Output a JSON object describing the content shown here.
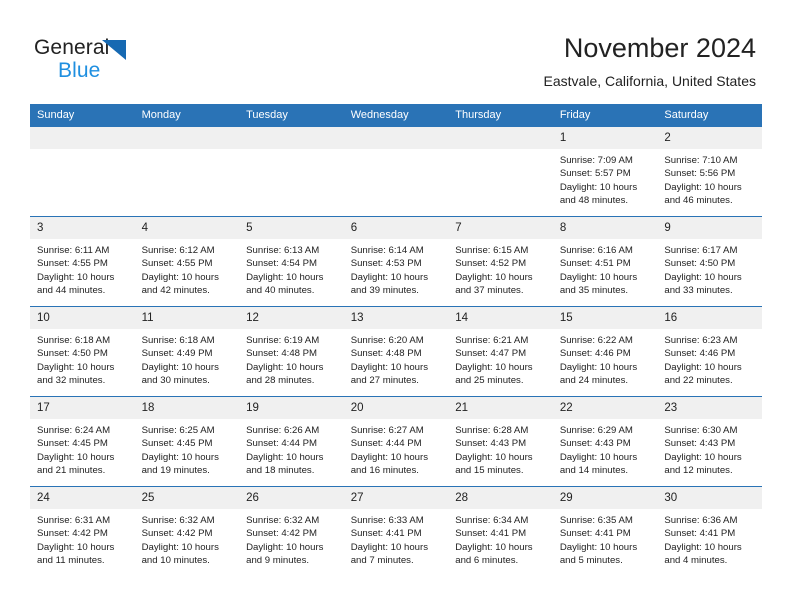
{
  "brand": {
    "name_top": "General",
    "name_bottom": "Blue",
    "accent_color": "#1f8fe0",
    "triangle_color": "#1669b2"
  },
  "header": {
    "title": "November 2024",
    "subtitle": "Eastvale, California, United States"
  },
  "theme": {
    "header_row_bg": "#2a73b6",
    "daynum_bg": "#f0f0f0",
    "grid_line": "#2a73b6",
    "text": "#222222"
  },
  "weekday_headers": [
    "Sunday",
    "Monday",
    "Tuesday",
    "Wednesday",
    "Thursday",
    "Friday",
    "Saturday"
  ],
  "weeks": [
    [
      {
        "day": "",
        "sunrise": "",
        "sunset": "",
        "daylight_1": "",
        "daylight_2": "",
        "empty": true
      },
      {
        "day": "",
        "sunrise": "",
        "sunset": "",
        "daylight_1": "",
        "daylight_2": "",
        "empty": true
      },
      {
        "day": "",
        "sunrise": "",
        "sunset": "",
        "daylight_1": "",
        "daylight_2": "",
        "empty": true
      },
      {
        "day": "",
        "sunrise": "",
        "sunset": "",
        "daylight_1": "",
        "daylight_2": "",
        "empty": true
      },
      {
        "day": "",
        "sunrise": "",
        "sunset": "",
        "daylight_1": "",
        "daylight_2": "",
        "empty": true
      },
      {
        "day": "1",
        "sunrise": "Sunrise: 7:09 AM",
        "sunset": "Sunset: 5:57 PM",
        "daylight_1": "Daylight: 10 hours",
        "daylight_2": "and 48 minutes."
      },
      {
        "day": "2",
        "sunrise": "Sunrise: 7:10 AM",
        "sunset": "Sunset: 5:56 PM",
        "daylight_1": "Daylight: 10 hours",
        "daylight_2": "and 46 minutes."
      }
    ],
    [
      {
        "day": "3",
        "sunrise": "Sunrise: 6:11 AM",
        "sunset": "Sunset: 4:55 PM",
        "daylight_1": "Daylight: 10 hours",
        "daylight_2": "and 44 minutes."
      },
      {
        "day": "4",
        "sunrise": "Sunrise: 6:12 AM",
        "sunset": "Sunset: 4:55 PM",
        "daylight_1": "Daylight: 10 hours",
        "daylight_2": "and 42 minutes."
      },
      {
        "day": "5",
        "sunrise": "Sunrise: 6:13 AM",
        "sunset": "Sunset: 4:54 PM",
        "daylight_1": "Daylight: 10 hours",
        "daylight_2": "and 40 minutes."
      },
      {
        "day": "6",
        "sunrise": "Sunrise: 6:14 AM",
        "sunset": "Sunset: 4:53 PM",
        "daylight_1": "Daylight: 10 hours",
        "daylight_2": "and 39 minutes."
      },
      {
        "day": "7",
        "sunrise": "Sunrise: 6:15 AM",
        "sunset": "Sunset: 4:52 PM",
        "daylight_1": "Daylight: 10 hours",
        "daylight_2": "and 37 minutes."
      },
      {
        "day": "8",
        "sunrise": "Sunrise: 6:16 AM",
        "sunset": "Sunset: 4:51 PM",
        "daylight_1": "Daylight: 10 hours",
        "daylight_2": "and 35 minutes."
      },
      {
        "day": "9",
        "sunrise": "Sunrise: 6:17 AM",
        "sunset": "Sunset: 4:50 PM",
        "daylight_1": "Daylight: 10 hours",
        "daylight_2": "and 33 minutes."
      }
    ],
    [
      {
        "day": "10",
        "sunrise": "Sunrise: 6:18 AM",
        "sunset": "Sunset: 4:50 PM",
        "daylight_1": "Daylight: 10 hours",
        "daylight_2": "and 32 minutes."
      },
      {
        "day": "11",
        "sunrise": "Sunrise: 6:18 AM",
        "sunset": "Sunset: 4:49 PM",
        "daylight_1": "Daylight: 10 hours",
        "daylight_2": "and 30 minutes."
      },
      {
        "day": "12",
        "sunrise": "Sunrise: 6:19 AM",
        "sunset": "Sunset: 4:48 PM",
        "daylight_1": "Daylight: 10 hours",
        "daylight_2": "and 28 minutes."
      },
      {
        "day": "13",
        "sunrise": "Sunrise: 6:20 AM",
        "sunset": "Sunset: 4:48 PM",
        "daylight_1": "Daylight: 10 hours",
        "daylight_2": "and 27 minutes."
      },
      {
        "day": "14",
        "sunrise": "Sunrise: 6:21 AM",
        "sunset": "Sunset: 4:47 PM",
        "daylight_1": "Daylight: 10 hours",
        "daylight_2": "and 25 minutes."
      },
      {
        "day": "15",
        "sunrise": "Sunrise: 6:22 AM",
        "sunset": "Sunset: 4:46 PM",
        "daylight_1": "Daylight: 10 hours",
        "daylight_2": "and 24 minutes."
      },
      {
        "day": "16",
        "sunrise": "Sunrise: 6:23 AM",
        "sunset": "Sunset: 4:46 PM",
        "daylight_1": "Daylight: 10 hours",
        "daylight_2": "and 22 minutes."
      }
    ],
    [
      {
        "day": "17",
        "sunrise": "Sunrise: 6:24 AM",
        "sunset": "Sunset: 4:45 PM",
        "daylight_1": "Daylight: 10 hours",
        "daylight_2": "and 21 minutes."
      },
      {
        "day": "18",
        "sunrise": "Sunrise: 6:25 AM",
        "sunset": "Sunset: 4:45 PM",
        "daylight_1": "Daylight: 10 hours",
        "daylight_2": "and 19 minutes."
      },
      {
        "day": "19",
        "sunrise": "Sunrise: 6:26 AM",
        "sunset": "Sunset: 4:44 PM",
        "daylight_1": "Daylight: 10 hours",
        "daylight_2": "and 18 minutes."
      },
      {
        "day": "20",
        "sunrise": "Sunrise: 6:27 AM",
        "sunset": "Sunset: 4:44 PM",
        "daylight_1": "Daylight: 10 hours",
        "daylight_2": "and 16 minutes."
      },
      {
        "day": "21",
        "sunrise": "Sunrise: 6:28 AM",
        "sunset": "Sunset: 4:43 PM",
        "daylight_1": "Daylight: 10 hours",
        "daylight_2": "and 15 minutes."
      },
      {
        "day": "22",
        "sunrise": "Sunrise: 6:29 AM",
        "sunset": "Sunset: 4:43 PM",
        "daylight_1": "Daylight: 10 hours",
        "daylight_2": "and 14 minutes."
      },
      {
        "day": "23",
        "sunrise": "Sunrise: 6:30 AM",
        "sunset": "Sunset: 4:43 PM",
        "daylight_1": "Daylight: 10 hours",
        "daylight_2": "and 12 minutes."
      }
    ],
    [
      {
        "day": "24",
        "sunrise": "Sunrise: 6:31 AM",
        "sunset": "Sunset: 4:42 PM",
        "daylight_1": "Daylight: 10 hours",
        "daylight_2": "and 11 minutes."
      },
      {
        "day": "25",
        "sunrise": "Sunrise: 6:32 AM",
        "sunset": "Sunset: 4:42 PM",
        "daylight_1": "Daylight: 10 hours",
        "daylight_2": "and 10 minutes."
      },
      {
        "day": "26",
        "sunrise": "Sunrise: 6:32 AM",
        "sunset": "Sunset: 4:42 PM",
        "daylight_1": "Daylight: 10 hours",
        "daylight_2": "and 9 minutes."
      },
      {
        "day": "27",
        "sunrise": "Sunrise: 6:33 AM",
        "sunset": "Sunset: 4:41 PM",
        "daylight_1": "Daylight: 10 hours",
        "daylight_2": "and 7 minutes."
      },
      {
        "day": "28",
        "sunrise": "Sunrise: 6:34 AM",
        "sunset": "Sunset: 4:41 PM",
        "daylight_1": "Daylight: 10 hours",
        "daylight_2": "and 6 minutes."
      },
      {
        "day": "29",
        "sunrise": "Sunrise: 6:35 AM",
        "sunset": "Sunset: 4:41 PM",
        "daylight_1": "Daylight: 10 hours",
        "daylight_2": "and 5 minutes."
      },
      {
        "day": "30",
        "sunrise": "Sunrise: 6:36 AM",
        "sunset": "Sunset: 4:41 PM",
        "daylight_1": "Daylight: 10 hours",
        "daylight_2": "and 4 minutes."
      }
    ]
  ]
}
